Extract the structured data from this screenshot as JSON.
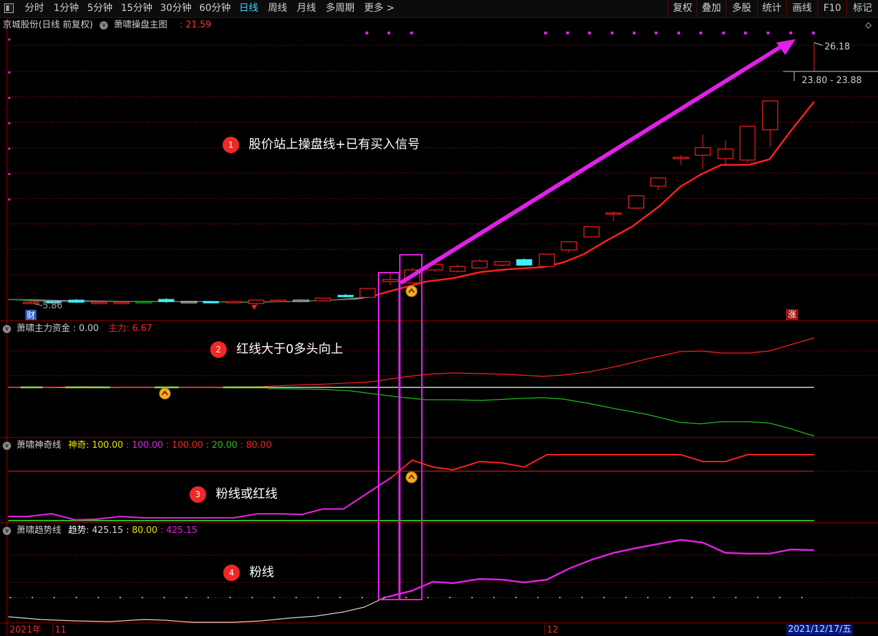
{
  "toolbar": {
    "periods": [
      "分时",
      "1分钟",
      "5分钟",
      "15分钟",
      "30分钟",
      "60分钟",
      "日线",
      "周线",
      "月线",
      "多周期",
      "更多"
    ],
    "active_period": "日线",
    "more_arrow": ">",
    "right_buttons": [
      "复权",
      "叠加",
      "多股",
      "统计",
      "画线",
      "F10",
      "标记"
    ]
  },
  "main_panel": {
    "stock_title": "京城股份(日线 前复权)",
    "indicator_name": "萧啸操盘主图",
    "indicator_value": ": 21.59",
    "high_label": "26.18",
    "range_label": "23.80 - 23.88",
    "low_label": "5.86",
    "cai_badge": "财",
    "zhang_badge": "涨"
  },
  "panel2": {
    "name": "萧啸主力资金",
    "value": ": 0.00",
    "sub_label": "主力",
    "sub_value": ": 6.67"
  },
  "panel3": {
    "name": "萧啸神奇线",
    "label": "神奇",
    "values": [
      ": 100.00",
      ": 100.00",
      ": 100.00",
      ": 20.00",
      ": 80.00"
    ]
  },
  "panel4": {
    "name": "萧啸趋势线",
    "label": "趋势",
    "values": [
      ": 425.15",
      ": 80.00",
      ": 425.15"
    ]
  },
  "annotations": [
    {
      "num": "1",
      "text": "股价站上操盘线+已有买入信号"
    },
    {
      "num": "2",
      "text": "红线大于0多头向上"
    },
    {
      "num": "3",
      "text": "粉线或红线"
    },
    {
      "num": "4",
      "text": "粉线"
    }
  ],
  "date_axis": {
    "year": "2021年",
    "m1": "11",
    "m2": "12",
    "current_date": "2021/12/17/五"
  },
  "colors": {
    "red": "#ff2020",
    "pink": "#e020e8",
    "green": "#20c020",
    "white": "#d8d8d8",
    "yellow": "#e8e800",
    "cyan": "#40f0ff",
    "grid": "#8a0000",
    "frame": "#a00000"
  }
}
